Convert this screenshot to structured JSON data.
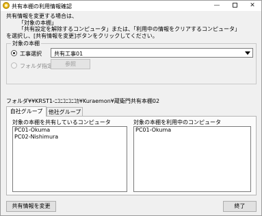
{
  "window": {
    "title": "共有本棚の利用情報確認",
    "min_glyph": "—",
    "close_glyph": "✕"
  },
  "intro": {
    "line1": "共有情報を変更する場合は、",
    "line2": "「対象の本棚」",
    "line3": "「共有設定を解除するコンピュータ」または、「利用中の情報をクリアするコンピュータ」",
    "line4": "を選択し、[共有情報を変更]ボタンをクリックしてください。"
  },
  "target_group": {
    "label": "対象の本棚",
    "work_select_label": "工事選択",
    "work_select_checked": true,
    "work_value": "共有工事01",
    "folder_select_label": "フォルダ指定",
    "browse_label": "参照"
  },
  "folder": {
    "label": "フォルダ",
    "path": "¥¥KRST1-ﾆｺﾆｺﾆｺﾆｺｶ¥Kuraemon¥蔵衛門共有本棚02"
  },
  "tabs": [
    {
      "label": "自社グループ",
      "active": true
    },
    {
      "label": "他社グループ",
      "active": false
    }
  ],
  "shared_list": {
    "caption": "対象の本棚を共有しているコンピュータ",
    "items": [
      "PC01-Okuma",
      "PC02-Nishimura"
    ]
  },
  "using_list": {
    "caption": "対象の本棚を利用中のコンピュータ",
    "items": [
      "PC01-Okuma"
    ]
  },
  "buttons": {
    "change_label": "共有情報を変更",
    "close_label": "終了"
  }
}
